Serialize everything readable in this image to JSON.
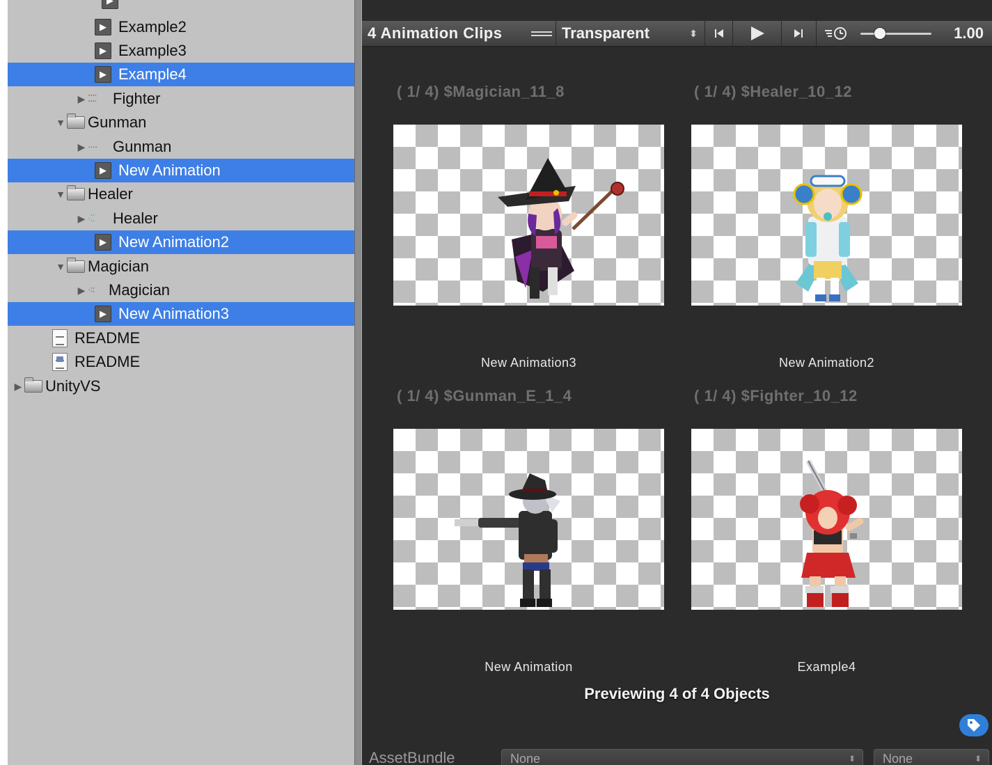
{
  "tree": {
    "rows": [
      {
        "label": "Example2",
        "kind": "clip",
        "selected": false
      },
      {
        "label": "Example3",
        "kind": "clip",
        "selected": false
      },
      {
        "label": "Example4",
        "kind": "clip",
        "selected": true
      },
      {
        "label": "Fighter",
        "kind": "sheet",
        "selected": false
      },
      {
        "label": "Gunman",
        "kind": "folder",
        "selected": false
      },
      {
        "label": "Gunman",
        "kind": "sheet",
        "selected": false
      },
      {
        "label": "New Animation",
        "kind": "clip",
        "selected": true
      },
      {
        "label": "Healer",
        "kind": "folder",
        "selected": false
      },
      {
        "label": "Healer",
        "kind": "sheet",
        "selected": false
      },
      {
        "label": "New Animation2",
        "kind": "clip",
        "selected": true
      },
      {
        "label": "Magician",
        "kind": "folder",
        "selected": false
      },
      {
        "label": "Magician",
        "kind": "sheet",
        "selected": false
      },
      {
        "label": "New Animation3",
        "kind": "clip",
        "selected": true
      },
      {
        "label": "README",
        "kind": "doc",
        "selected": false
      },
      {
        "label": "README",
        "kind": "doc",
        "selected": false
      },
      {
        "label": "UnityVS",
        "kind": "folder",
        "selected": false
      }
    ]
  },
  "toolbar": {
    "title": "4 Animation Clips",
    "background": "Transparent",
    "speed_value": "1.00",
    "speed_fraction": 0.25
  },
  "preview": {
    "cells": [
      {
        "header": "( 1/ 4) $Magician_11_8",
        "label": "New Animation3",
        "sprite": "magician"
      },
      {
        "header": "( 1/ 4) $Healer_10_12",
        "label": "New Animation2",
        "sprite": "healer"
      },
      {
        "header": "( 1/ 4) $Gunman_E_1_4",
        "label": "New Animation",
        "sprite": "gunman"
      },
      {
        "header": "( 1/ 4) $Fighter_10_12",
        "label": "Example4",
        "sprite": "fighter"
      }
    ],
    "count_text": "Previewing 4 of 4 Objects"
  },
  "assetbundle": {
    "label": "AssetBundle",
    "bundle_value": "None",
    "variant_value": "None"
  },
  "colors": {
    "selection": "#3d7fe6",
    "tree_background": "#c2c2c2",
    "preview_background": "#2b2b2b",
    "tag_button": "#2f7fd8"
  }
}
